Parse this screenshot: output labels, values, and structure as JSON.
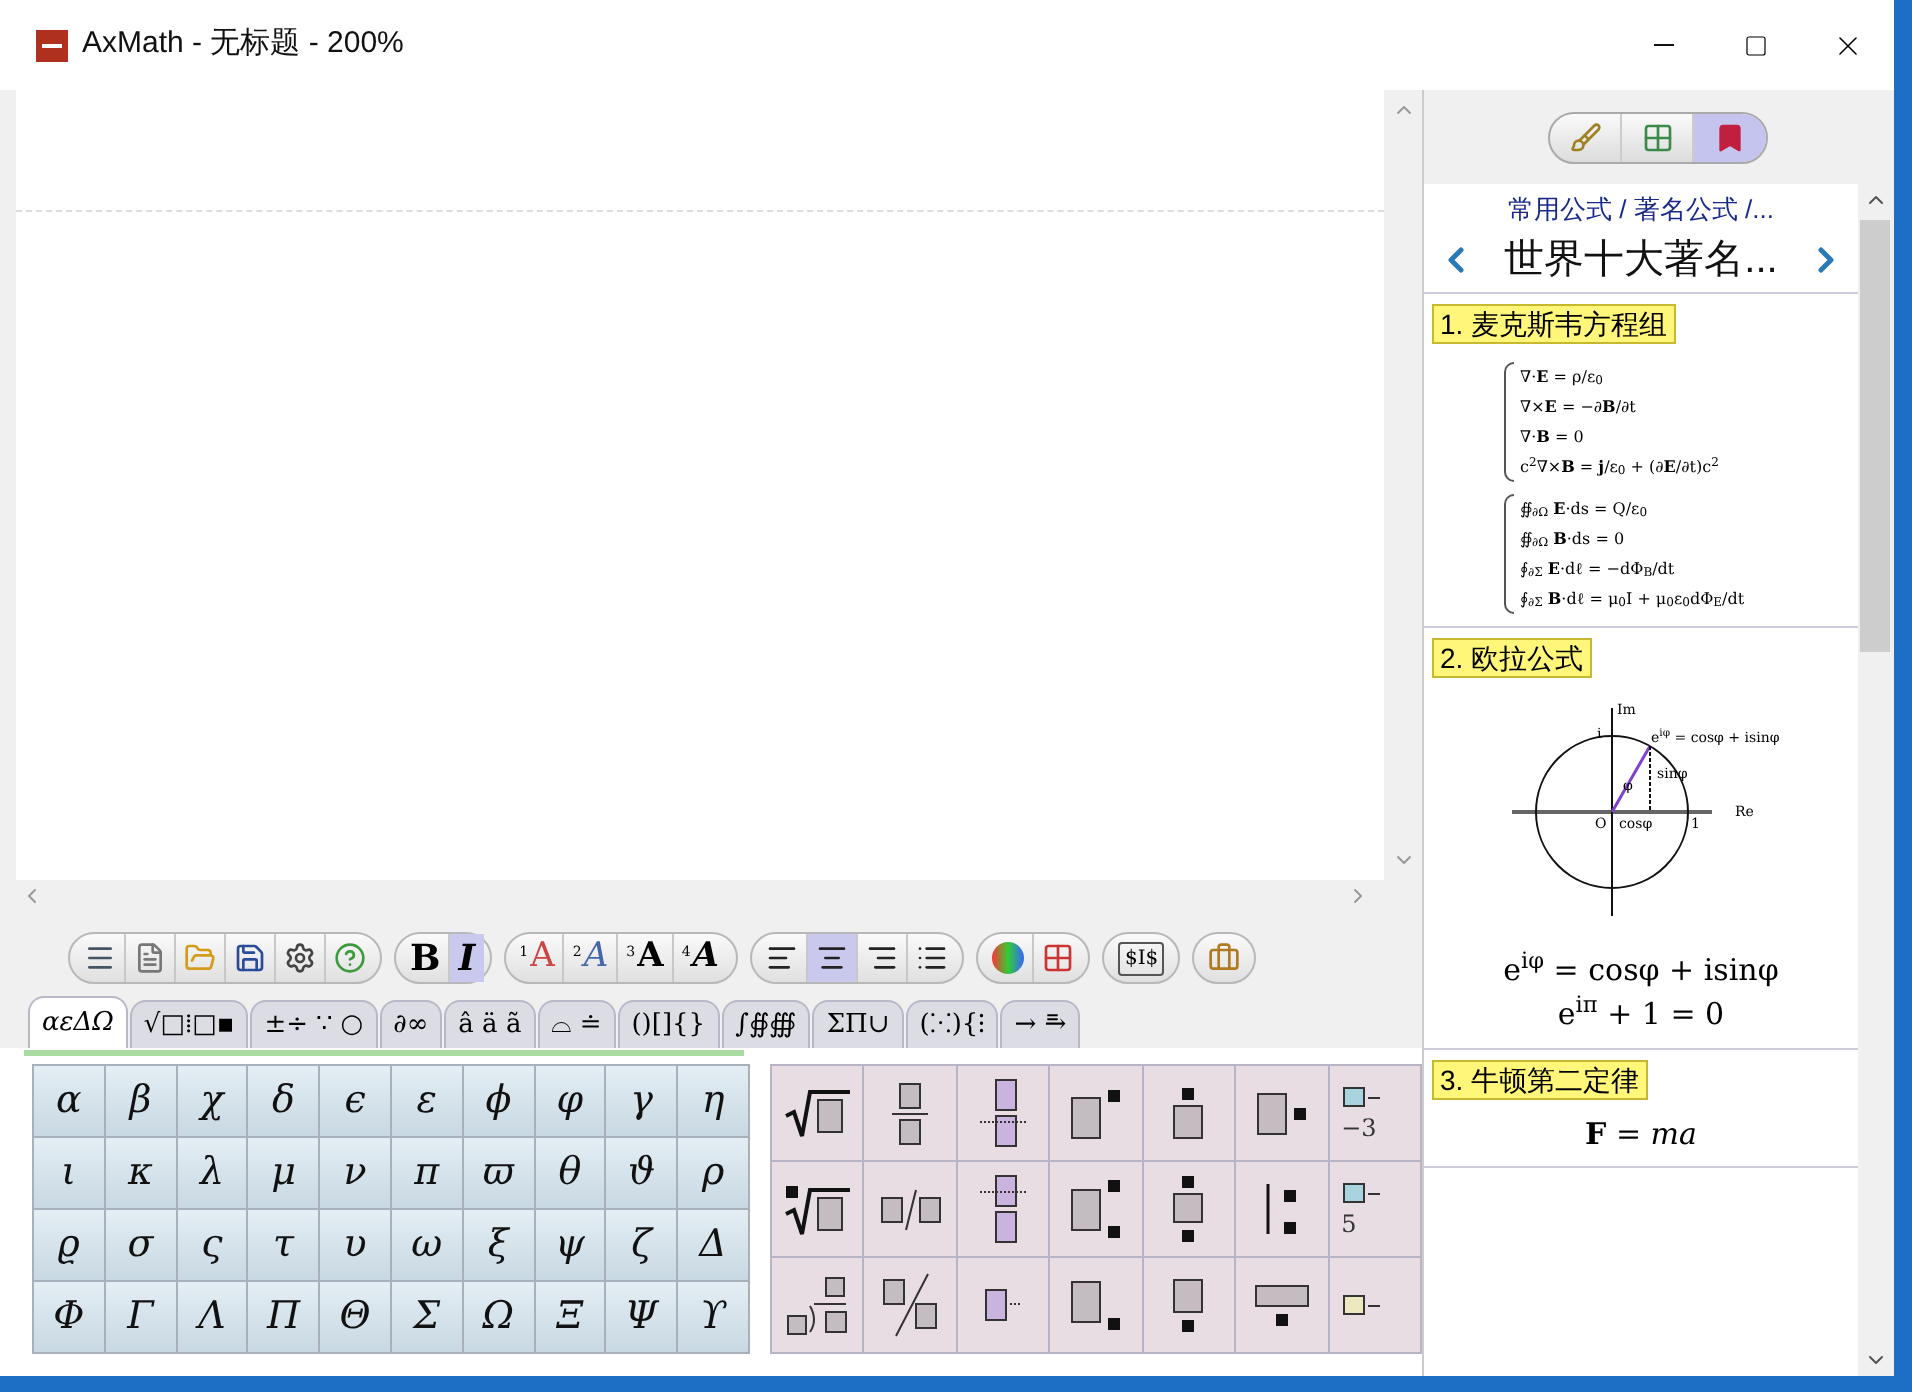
{
  "window": {
    "title": "AxMath - 无标题 - 200%"
  },
  "toolbar": {
    "groups": [
      {
        "buttons": [
          {
            "pressed": false
          },
          {
            "pressed": false
          },
          {
            "pressed": false
          },
          {
            "pressed": false
          },
          {
            "pressed": false
          },
          {
            "pressed": false
          }
        ]
      },
      {
        "buttons": [
          {
            "label": "B",
            "pressed": false
          },
          {
            "label": "I",
            "pressed": true
          }
        ]
      },
      {
        "buttons": [
          {
            "label": "A",
            "index": "1",
            "pressed": false
          },
          {
            "label": "A",
            "index": "2",
            "pressed": false
          },
          {
            "label": "A",
            "index": "3",
            "pressed": false
          },
          {
            "label": "A",
            "index": "4",
            "pressed": false
          }
        ]
      },
      {
        "buttons": [
          {
            "pressed": false
          },
          {
            "pressed": true
          },
          {
            "pressed": false
          },
          {
            "pressed": false
          }
        ]
      },
      {
        "buttons": [
          {
            "pressed": false
          },
          {
            "pressed": false
          }
        ]
      },
      {
        "buttons": [
          {
            "label": "$I$",
            "pressed": false
          }
        ]
      },
      {
        "buttons": [
          {
            "pressed": false
          }
        ]
      }
    ]
  },
  "tabs": [
    {
      "label": "αεΔΩ",
      "selected": true
    },
    {
      "label": "√□⁞□▪",
      "selected": false
    },
    {
      "label": "±÷ ∵ ○",
      "selected": false
    },
    {
      "label": "∂∞",
      "selected": false
    },
    {
      "label": "â ä ã",
      "selected": false
    },
    {
      "label": "⌓ ≐",
      "selected": false
    },
    {
      "label": "()[]{}",
      "selected": false
    },
    {
      "label": "∫∯∰",
      "selected": false
    },
    {
      "label": "ΣΠ∪",
      "selected": false
    },
    {
      "label": "(⁙){⁝",
      "selected": false
    },
    {
      "label": "→ ⥱",
      "selected": false
    }
  ],
  "greek": [
    "α",
    "β",
    "χ",
    "δ",
    "ϵ",
    "ε",
    "ϕ",
    "φ",
    "γ",
    "η",
    "ι",
    "κ",
    "λ",
    "μ",
    "ν",
    "π",
    "ϖ",
    "θ",
    "ϑ",
    "ρ",
    "ϱ",
    "σ",
    "ς",
    "τ",
    "υ",
    "ω",
    "ξ",
    "ψ",
    "ζ",
    "Δ",
    "Φ",
    "Γ",
    "Λ",
    "Π",
    "Θ",
    "Σ",
    "Ω",
    "Ξ",
    "Ψ",
    "ϒ"
  ],
  "templates": [
    {
      "kind": "sqrt"
    },
    {
      "kind": "frac"
    },
    {
      "kind": "stack-up"
    },
    {
      "kind": "sup"
    },
    {
      "kind": "over"
    },
    {
      "kind": "side"
    },
    {
      "kind": "partial",
      "text": "−3"
    },
    {
      "kind": "nroot"
    },
    {
      "kind": "slash"
    },
    {
      "kind": "stack-down"
    },
    {
      "kind": "supsub"
    },
    {
      "kind": "overunder"
    },
    {
      "kind": "bar-supsub"
    },
    {
      "kind": "partial",
      "text": "5"
    },
    {
      "kind": "longdiv"
    },
    {
      "kind": "diag"
    },
    {
      "kind": "stack-mid"
    },
    {
      "kind": "sub"
    },
    {
      "kind": "under"
    },
    {
      "kind": "under-wide"
    },
    {
      "kind": "partial"
    }
  ],
  "panel": {
    "modes": [
      {
        "selected": false
      },
      {
        "selected": false
      },
      {
        "selected": true
      }
    ],
    "breadcrumb": "常用公式 / 著名公式 /...",
    "title": "世界十大著名...",
    "sections": [
      {
        "label": "1. 麦克斯韦方程组",
        "kind": "systems",
        "groups": [
          [
            "∇·**E** = ρ/ε$_{0}$",
            "∇×**E** = −∂**B**/∂t",
            "∇·**B** = 0",
            "c$^{2}$∇×**B** = **j**/ε$_{0}$ + (∂**E**/∂t)c$^{2}$"
          ],
          [
            "∯$_{∂Ω}$ **E**·ds = Q/ε$_{0}$",
            "∯$_{∂Ω}$ **B**·ds = 0",
            "∮$_{∂Σ}$ **E**·dℓ = −dΦ$_{B}$/dt",
            "∮$_{∂Σ}$ **B**·dℓ = μ$_{0}$I + μ$_{0}$ε$_{0}$dΦ$_{E}$/dt"
          ]
        ]
      },
      {
        "label": "2. 欧拉公式",
        "kind": "euler",
        "diagram": {
          "im": "Im",
          "i": "i",
          "point": "e$^{iφ}$ = cosφ + isinφ",
          "sin": "sinφ",
          "angle": "φ",
          "origin": "O",
          "cos": "cosφ",
          "one": "1",
          "re": "Re"
        },
        "lines": [
          "e$^{iφ}$ = cosφ + isinφ",
          "e$^{iπ}$ + 1 = 0"
        ]
      },
      {
        "label": "3. 牛顿第二定律",
        "kind": "lines",
        "lines": [
          "**F** = *ma*"
        ]
      }
    ]
  }
}
